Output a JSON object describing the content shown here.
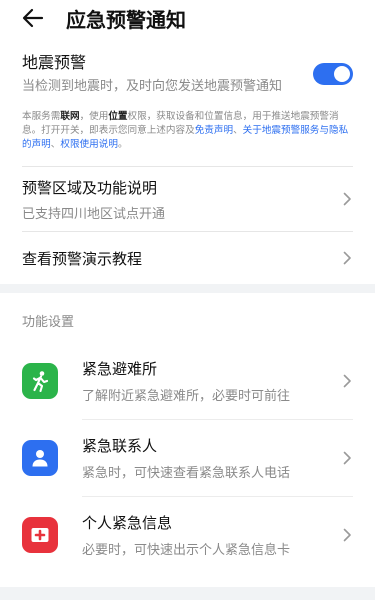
{
  "header": {
    "title": "应急预警通知",
    "back_icon": "arrow-left-icon"
  },
  "earthquake": {
    "title": "地震预警",
    "desc": "当检测到地震时，及时向您发送地震预警通知",
    "enabled": true,
    "accent": "#2d6ff0"
  },
  "notice": {
    "p1": "本服务需",
    "w1": "联网",
    "p2": "，使用",
    "w2": "位置",
    "p3": "权限，获取设备和位置信息，用于推送地震预警消息。打开开关，即表示您同意上述内容及",
    "link1": "免责声明",
    "sep": "、",
    "link2": "关于地震预警服务与隐私的声明",
    "sep2": "、",
    "link3": "权限使用说明",
    "end": "。"
  },
  "region": {
    "title": "预警区域及功能说明",
    "subtitle": "已支持四川地区试点开通"
  },
  "demo": {
    "title": "查看预警演示教程"
  },
  "settings": {
    "section_title": "功能设置",
    "items": [
      {
        "title": "紧急避难所",
        "subtitle": "了解附近紧急避难所，必要时可前往",
        "color": "#2bb44a",
        "icon": "running-person-icon"
      },
      {
        "title": "紧急联系人",
        "subtitle": "紧急时，可快速查看紧急联系人电话",
        "color": "#2d6ff0",
        "icon": "contact-person-icon"
      },
      {
        "title": "个人紧急信息",
        "subtitle": "必要时，可快速出示个人紧急信息卡",
        "color": "#e8323c",
        "icon": "medical-cross-icon"
      }
    ]
  }
}
